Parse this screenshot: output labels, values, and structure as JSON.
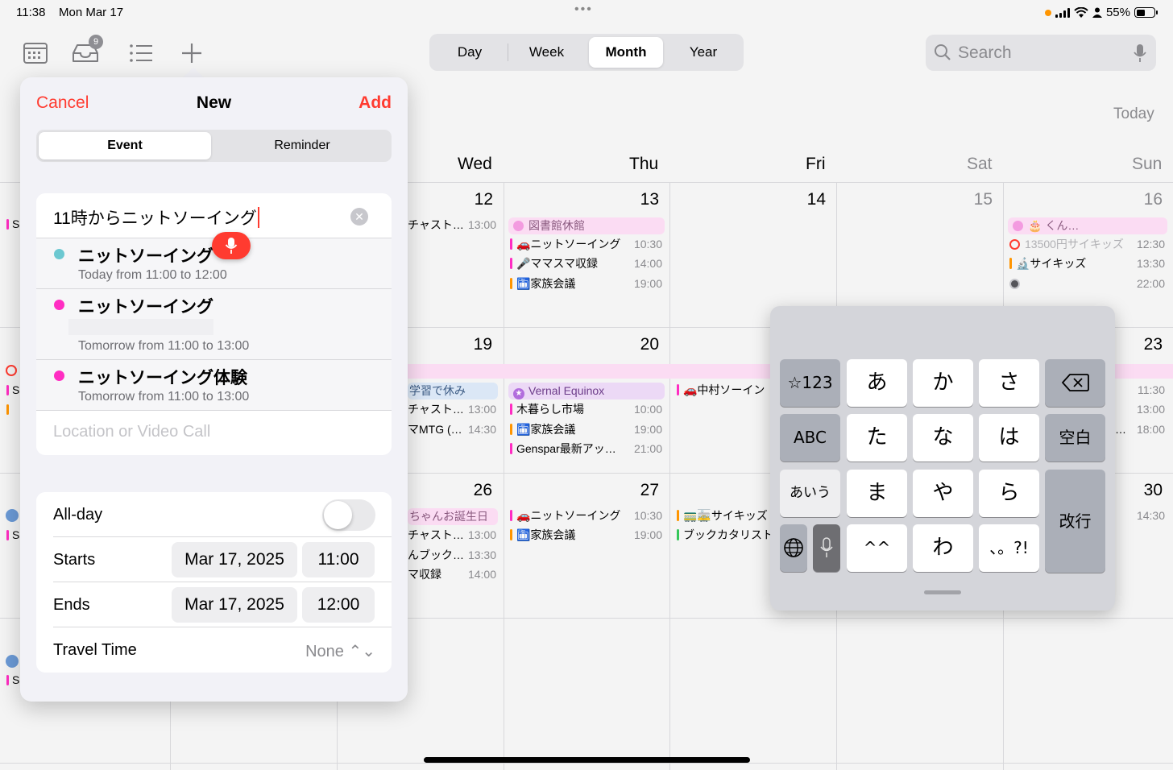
{
  "status_bar": {
    "time": "11:38",
    "date": "Mon Mar 17",
    "battery": "55%"
  },
  "toolbar": {
    "inbox_badge": "9"
  },
  "view_switcher": {
    "options": [
      "Day",
      "Week",
      "Month",
      "Year"
    ],
    "selected": "Month"
  },
  "search": {
    "placeholder": "Search"
  },
  "today_button": "Today",
  "weekdays": {
    "wed": "Wed",
    "thu": "Thu",
    "fri": "Fri",
    "sat": "Sat",
    "sun": "Sun"
  },
  "calendar": {
    "week1": {
      "d12": {
        "num": "12",
        "e1": "チャスト…",
        "t1": "13:00"
      },
      "d13": {
        "num": "13",
        "allday": "図書館休館",
        "e1": "🚗ニットソーイング",
        "t1": "10:30",
        "e2": "🎤ママスマ収録",
        "t2": "14:00",
        "e3": "🛅家族会議",
        "t3": "19:00"
      },
      "d14": {
        "num": "14"
      },
      "d15": {
        "num": "15"
      },
      "d16": {
        "num": "16",
        "allday": "🎂                 くん…",
        "e1": "13500円サイキッズ",
        "t1": "12:30",
        "e2": "🔬サイキッズ",
        "t2": "13:30",
        "t3": "22:00"
      }
    },
    "week2": {
      "d19": {
        "num": "19",
        "allday": "学習で休み",
        "e1": "チャスト…",
        "t1": "13:00",
        "e2": "マMTG (…",
        "t2": "14:30"
      },
      "d20": {
        "num": "20",
        "allday": "Vernal Equinox",
        "e1": "木暮らし市場",
        "t1": "10:00",
        "e2": "🛅家族会議",
        "t2": "19:00",
        "e3": "Genspar最新アッ…",
        "t3": "21:00"
      },
      "d21": {
        "e1": "🚗中村ソーイン"
      },
      "d23": {
        "num": "23",
        "t1": "11:30",
        "t2": "13:00",
        "e3": "…",
        "t3": "18:00"
      }
    },
    "week3": {
      "d26": {
        "num": "26",
        "allday": "ちゃんお誕生日",
        "e1": "チャスト…",
        "t1": "13:00",
        "e2": "んブック…",
        "t2": "13:30",
        "e3": "マ収録",
        "t3": "14:00"
      },
      "d27": {
        "num": "27",
        "e1": "🚗ニットソーイング",
        "t1": "10:30",
        "e2": "🛅家族会議",
        "t2": "19:00"
      },
      "d28": {
        "e1": "🚃🚋サイキッズ",
        "e2": "ブックカタリスト"
      },
      "d30": {
        "num": "30",
        "t1": "14:30"
      }
    },
    "left_edge": {
      "e1": "S",
      "e2": "S",
      "e3": "S",
      "e4": "S"
    },
    "colors": {
      "red": "#ff3b30",
      "magenta": "#ff2dc2",
      "orange": "#ff9500",
      "teal": "#6cc8d1",
      "green": "#34c759",
      "pink_bg": "#fbdcf3",
      "blue_bg": "#dbe7f6"
    }
  },
  "new_event": {
    "cancel": "Cancel",
    "title": "New",
    "add": "Add",
    "segments": {
      "event": "Event",
      "reminder": "Reminder"
    },
    "title_value": "11時からニットソーイング",
    "suggestions": [
      {
        "title": "ニットソーイング",
        "time": "Today from 11:00 to 12:00",
        "color": "#6cc8d1"
      },
      {
        "title": "ニットソーイング",
        "time": "Tomorrow from 11:00 to 13:00",
        "color": "#ff2dc2"
      },
      {
        "title": "ニットソーイング体験",
        "time": "Tomorrow from 11:00 to 13:00",
        "color": "#ff2dc2"
      }
    ],
    "location_placeholder": "Location or Video Call",
    "allday_label": "All-day",
    "allday_on": false,
    "starts_label": "Starts",
    "starts_date": "Mar 17, 2025",
    "starts_time": "11:00",
    "ends_label": "Ends",
    "ends_date": "Mar 17, 2025",
    "ends_time": "12:00",
    "travel_label": "Travel Time",
    "travel_value": "None ⌃⌄"
  },
  "keyboard": {
    "row1": [
      "☆123",
      "あ",
      "か",
      "さ"
    ],
    "row2": [
      "ABC",
      "た",
      "な",
      "は",
      "空白"
    ],
    "row3": [
      "あいう",
      "ま",
      "や",
      "ら",
      "改行"
    ],
    "row4": [
      "^^",
      "わ",
      "、。?!"
    ]
  }
}
